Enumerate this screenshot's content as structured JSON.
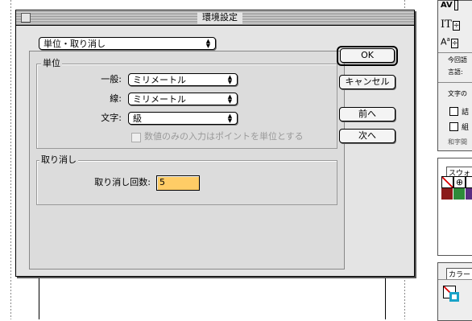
{
  "dialog": {
    "title": "環境設定",
    "panel_select": "単位・取り消し",
    "units": {
      "group_label": "単位",
      "general_label": "一般:",
      "general_value": "ミリメートル",
      "stroke_label": "線:",
      "stroke_value": "ミリメートル",
      "type_label": "文字:",
      "type_value": "級",
      "numbers_only_checkbox": "数値のみの入力はポイントを単位とする"
    },
    "undo": {
      "group_label": "取り消し",
      "levels_label": "取り消し回数:",
      "levels_value": "5"
    },
    "buttons": {
      "ok": "OK",
      "cancel": "キャンセル",
      "prev": "前へ",
      "next": "次へ"
    }
  },
  "right_panels": {
    "type_panel": {
      "kerning_glyph": "AV",
      "tracking_glyph": "IT",
      "baseline_glyph": "A",
      "line1": "今回語",
      "line2": "言語:",
      "line3": "文字の",
      "check1": "詰",
      "check2": "組",
      "line4": "和字間"
    },
    "swatches_tab": "スウォ",
    "color_tab": "カラー"
  },
  "colors": {
    "dialog_bg": "#e4e4e4",
    "field_highlight": "#ffcc66",
    "swatch_red": "#8b1a1a",
    "swatch_green": "#2e8b3a",
    "swatch_purple": "#5a2d82",
    "fill_cyan": "#1aa3c8"
  }
}
